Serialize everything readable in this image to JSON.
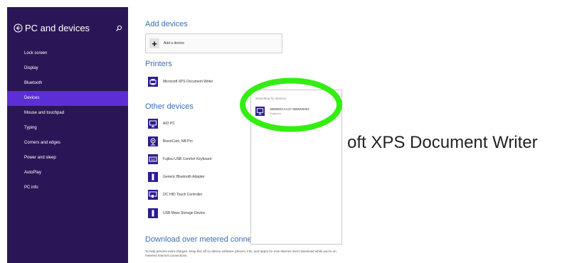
{
  "sidebar": {
    "title": "PC and devices",
    "items": [
      {
        "label": "Lock screen"
      },
      {
        "label": "Display"
      },
      {
        "label": "Bluetooth"
      },
      {
        "label": "Devices"
      },
      {
        "label": "Mouse and touchpad"
      },
      {
        "label": "Typing"
      },
      {
        "label": "Corners and edges"
      },
      {
        "label": "Power and sleep"
      },
      {
        "label": "AutoPlay"
      },
      {
        "label": "PC info"
      }
    ],
    "selected_index": 3,
    "colors": {
      "background": "#2a1657",
      "selected": "#5b2fd5"
    }
  },
  "main": {
    "add_devices": {
      "title": "Add devices",
      "button_label": "Add a device"
    },
    "printers": {
      "title": "Printers",
      "items": [
        {
          "label": "Microsoft XPS Document Writer",
          "icon": "printer-icon"
        }
      ]
    },
    "other_devices": {
      "title": "Other devices",
      "items": [
        {
          "label": "AIO PC",
          "icon": "monitor-icon"
        },
        {
          "label": "BisonCam, NB Pro",
          "icon": "webcam-icon"
        },
        {
          "label": "Fujitsu USB Comfort Keyboard",
          "icon": "keyboard-icon"
        },
        {
          "label": "Generic Bluetooth Adapter",
          "icon": "usb-device-icon"
        },
        {
          "label": "I2C HID Touch Controller",
          "icon": "touch-controller-icon"
        },
        {
          "label": "USB Mass Storage Device",
          "icon": "usb-device-icon"
        }
      ]
    },
    "download": {
      "title": "Download over metered connections",
      "description": "To help prevent extra charges, keep this off so device software (drivers, info, and apps) for new devices won't download while you're on metered Internet connections."
    },
    "accent_color": "#3b6fb2"
  },
  "popup": {
    "status": "Searching for devices",
    "device_name": "SBWEDCAA47-SBWD0004",
    "device_sub": "Projector"
  },
  "zoom_callout": {
    "text": "oft XPS Document Writer"
  },
  "highlight_color": "#33ee11"
}
